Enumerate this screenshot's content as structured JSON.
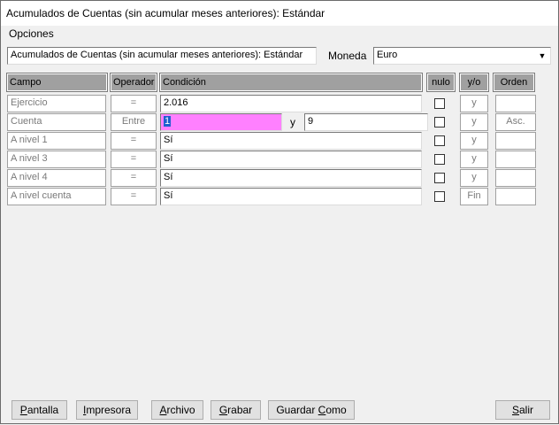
{
  "window": {
    "title": "Acumulados de Cuentas (sin acumular meses anteriores): Estándar"
  },
  "menu": {
    "opciones": "Opciones"
  },
  "report_name": {
    "value": "Acumulados de Cuentas (sin acumular meses anteriores): Estándar"
  },
  "currency": {
    "label": "Moneda",
    "value": "Euro"
  },
  "headers": {
    "campo": "Campo",
    "operador": "Operador",
    "condicion": "Condición",
    "nulo": "nulo",
    "yo": "y/o",
    "orden": "Orden"
  },
  "rows": [
    {
      "campo": "Ejercicio",
      "operador": "=",
      "condicion": "2.016",
      "yo": "y",
      "orden": ""
    },
    {
      "campo": "Cuenta",
      "operador": "Entre",
      "condicion": "1",
      "condicion_and": "y",
      "condicion2": "9",
      "yo": "y",
      "orden": "Asc."
    },
    {
      "campo": "A nivel 1",
      "operador": "=",
      "condicion": "Sí",
      "yo": "y",
      "orden": ""
    },
    {
      "campo": "A nivel 3",
      "operador": "=",
      "condicion": "Sí",
      "yo": "y",
      "orden": ""
    },
    {
      "campo": "A nivel 4",
      "operador": "=",
      "condicion": "Sí",
      "yo": "y",
      "orden": ""
    },
    {
      "campo": "A nivel cuenta",
      "operador": "=",
      "condicion": "Sí",
      "yo": "Fin",
      "orden": ""
    }
  ],
  "buttons": {
    "pantalla": {
      "pre": "",
      "key": "P",
      "post": "antalla"
    },
    "impresora": {
      "pre": "",
      "key": "I",
      "post": "mpresora"
    },
    "archivo": {
      "pre": "",
      "key": "A",
      "post": "rchivo"
    },
    "grabar": {
      "pre": "",
      "key": "G",
      "post": "rabar"
    },
    "guardar_como": {
      "pre": "Guardar ",
      "key": "C",
      "post": "omo"
    },
    "salir": {
      "pre": "",
      "key": "S",
      "post": "alir"
    }
  },
  "icons": {
    "dropdown": "chevron-down-icon"
  }
}
